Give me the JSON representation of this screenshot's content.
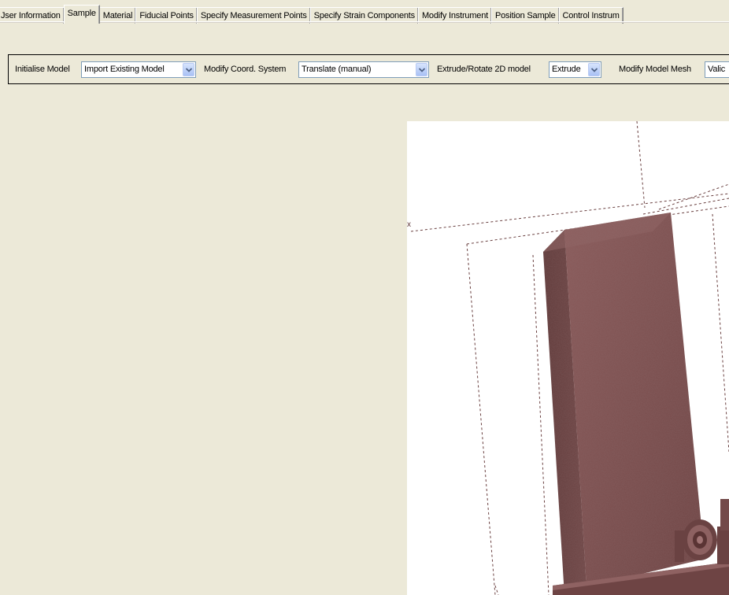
{
  "tabs": [
    {
      "label": "Jser Information"
    },
    {
      "label": "Sample"
    },
    {
      "label": "Material"
    },
    {
      "label": "Fiducial Points"
    },
    {
      "label": "Specify Measurement Points"
    },
    {
      "label": "Specify Strain Components"
    },
    {
      "label": "Modify Instrument"
    },
    {
      "label": "Position Sample"
    },
    {
      "label": "Control Instrum"
    }
  ],
  "active_tab": "Sample",
  "toolbar": {
    "initialise_label": "Initialise Model",
    "initialise_value": "Import Existing Model",
    "coord_label": "Modify Coord. System",
    "coord_value": "Translate (manual)",
    "extrude_label": "Extrude/Rotate 2D model",
    "extrude_value": "Extrude",
    "mesh_label": "Modify Model Mesh",
    "mesh_value": "Valic"
  },
  "viewport": {
    "axis_label": "x",
    "model_color": "#7b4e4e",
    "bounding_box_color": "#6a4040"
  },
  "colors": {
    "window_bg": "#ece9d8",
    "viewport_bg": "#ffffff",
    "combo_border": "#7f9db9"
  }
}
